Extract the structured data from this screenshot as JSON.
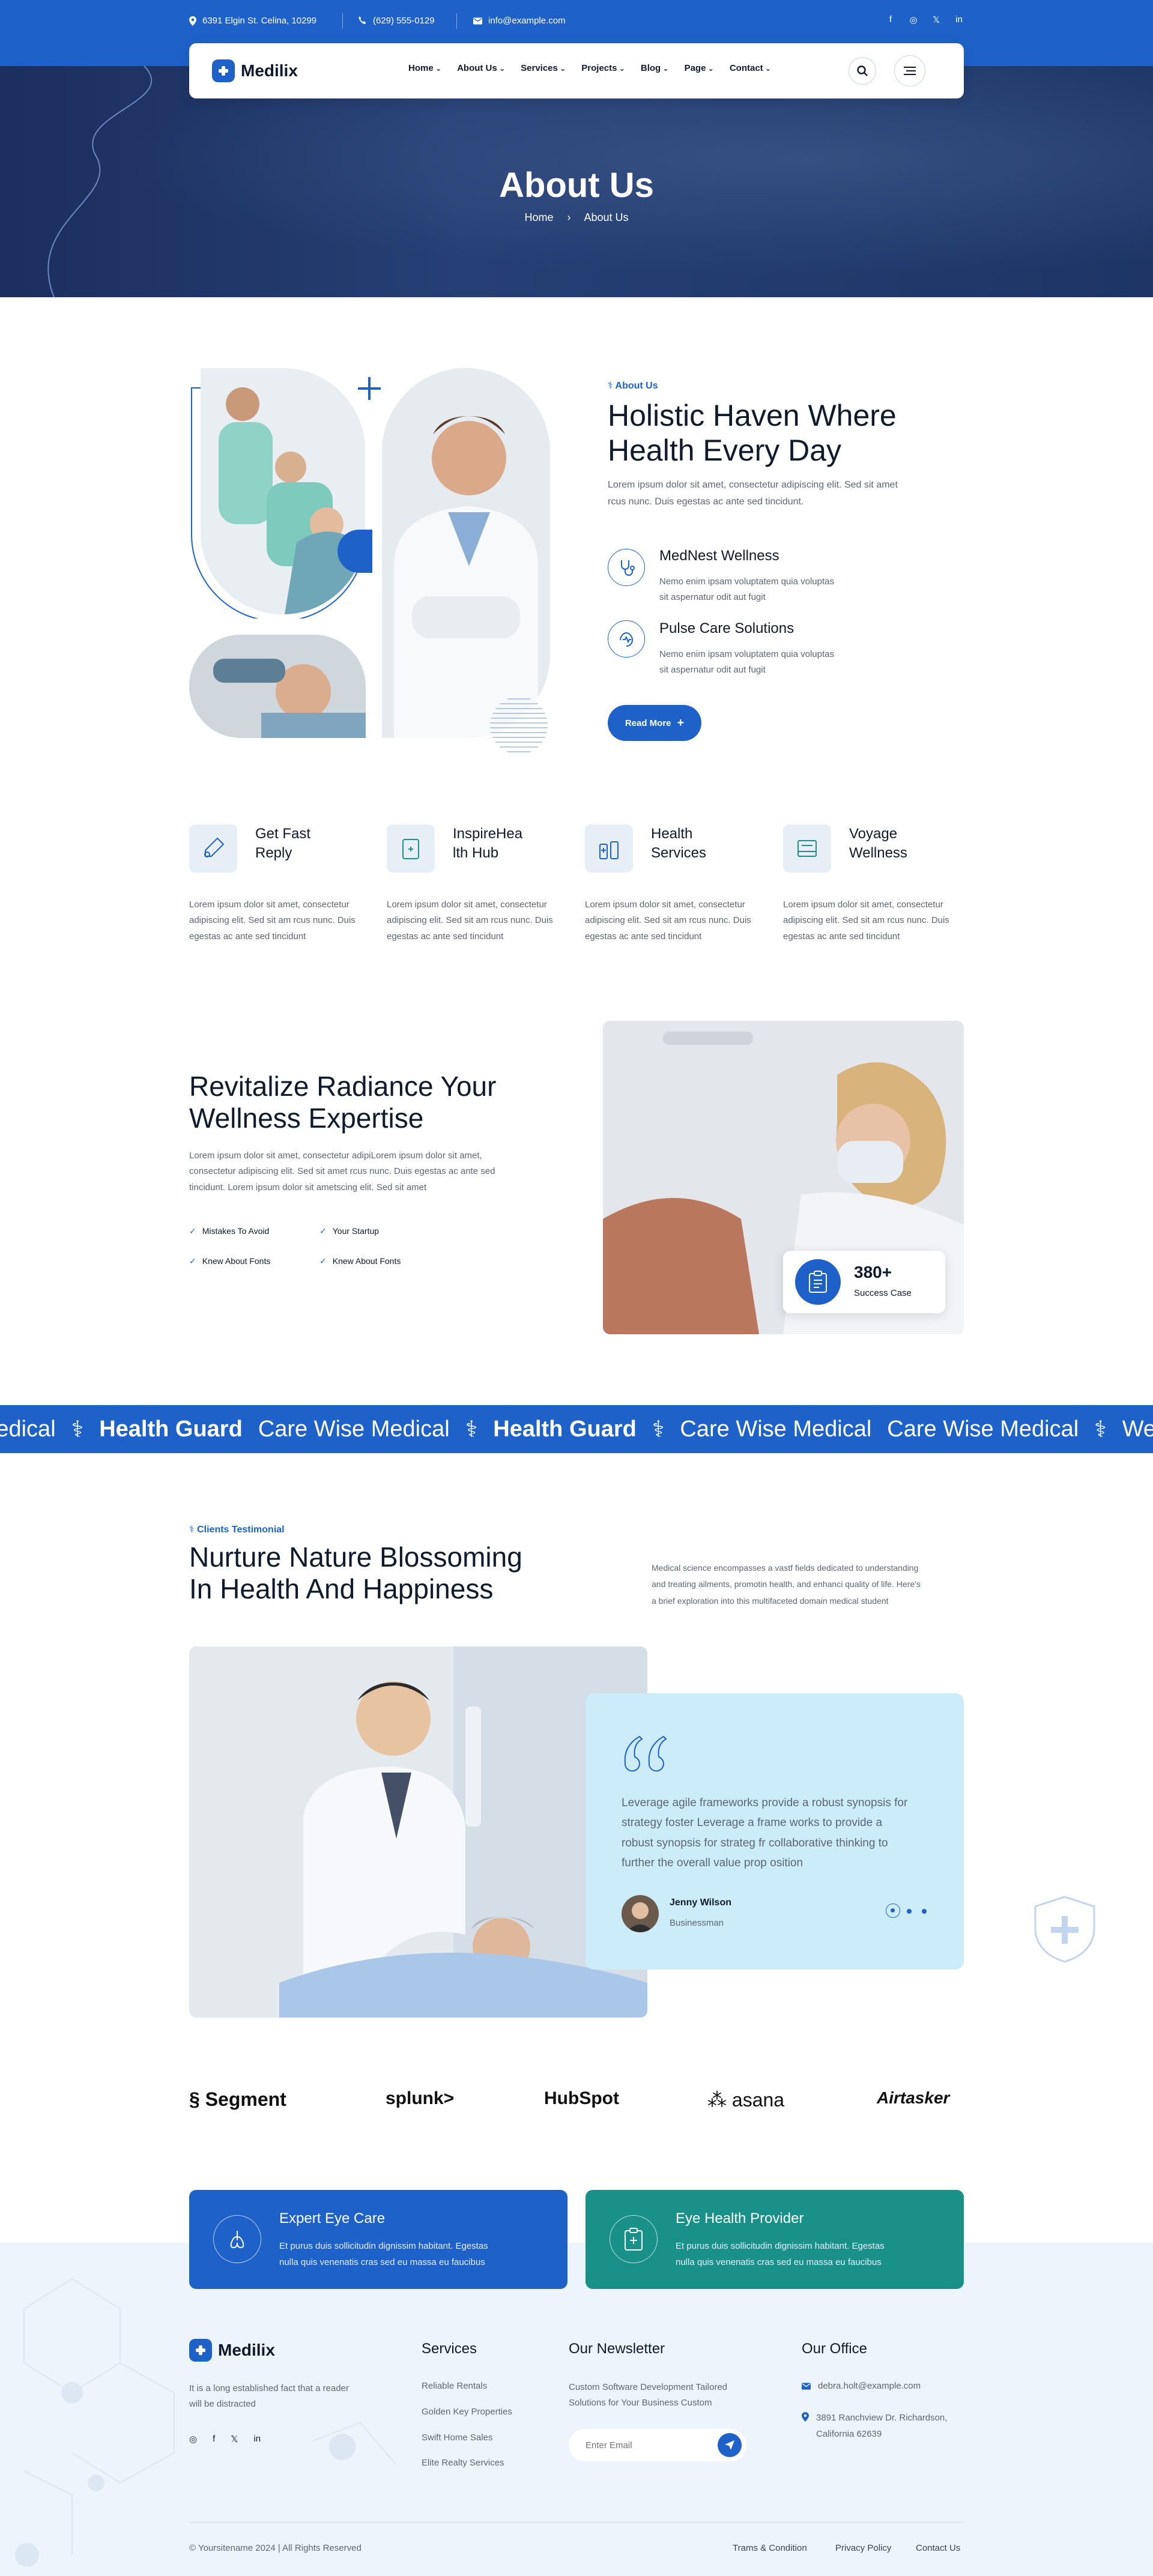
{
  "topbar": {
    "address": "6391 Elgin St. Celina, 10299",
    "phone": "(629) 555-0129",
    "email": "info@example.com",
    "social": [
      "f",
      "◎",
      "𝕏",
      "in"
    ]
  },
  "nav": {
    "logo": "Medilix",
    "menu": [
      "Home",
      "About Us",
      "Services",
      "Projects",
      "Blog",
      "Page",
      "Contact"
    ]
  },
  "hero": {
    "title": "About Us",
    "crumb_home": "Home",
    "crumb_sep": "›",
    "crumb_current": "About Us"
  },
  "about": {
    "tag": "About Us",
    "title_line1": "Holistic Haven Where",
    "title_line2": "Health Every Day",
    "text_line1": "Lorem ipsum dolor sit amet, consectetur adipiscing elit. Sed sit amet",
    "text_line2": "rcus nunc. Duis egestas ac ante sed tincidunt.",
    "features": [
      {
        "title": "MedNest Wellness",
        "line1": "Nemo enim ipsam voluptatem quia voluptas",
        "line2": "sit aspernatur odit aut fugit"
      },
      {
        "title": "Pulse Care Solutions",
        "line1": "Nemo enim ipsam voluptatem quia voluptas",
        "line2": "sit aspernatur odit aut fugit"
      }
    ],
    "button": "Read More",
    "button_icon": "+"
  },
  "services": [
    {
      "line1": "Get Fast",
      "line2": "Reply",
      "d1": "Lorem ipsum dolor sit amet, consectetur",
      "d2": "adipiscing elit. Sed sit am rcus nunc. Duis",
      "d3": "egestas ac ante sed tincidunt"
    },
    {
      "line1": "InspireHea",
      "line2": "lth Hub",
      "d1": "Lorem ipsum dolor sit amet, consectetur",
      "d2": "adipiscing elit. Sed sit am rcus nunc. Duis",
      "d3": "egestas ac ante sed tincidunt"
    },
    {
      "line1": "Health",
      "line2": "Services",
      "d1": "Lorem ipsum dolor sit amet, consectetur",
      "d2": "adipiscing elit. Sed sit am rcus nunc. Duis",
      "d3": "egestas ac ante sed tincidunt"
    },
    {
      "line1": "Voyage",
      "line2": "Wellness",
      "d1": "Lorem ipsum dolor sit amet, consectetur",
      "d2": "adipiscing elit. Sed sit am rcus nunc. Duis",
      "d3": "egestas ac ante sed tincidunt"
    }
  ],
  "revitalize": {
    "title_line1": "Revitalize Radiance Your",
    "title_line2": "Wellness Expertise",
    "text_line1": "Lorem ipsum dolor sit amet, consectetur adipiLorem ipsum dolor sit amet,",
    "text_line2": "consectetur adipiscing elit. Sed sit amet rcus nunc. Duis egestas ac ante sed",
    "text_line3": "tincidunt. Lorem ipsum dolor sit ametscing elit. Sed sit amet",
    "checks": [
      "Mistakes To Avoid",
      "Your Startup",
      "Knew About Fonts",
      "Knew About Fonts"
    ],
    "stat_value": "380+",
    "stat_label": "Success Case"
  },
  "marquee": [
    "e Medical",
    "Health Guard",
    "Care Wise Medical",
    "Health Guard",
    "Care Wise Medical",
    "Care Wise Medical",
    "Well"
  ],
  "testimonial": {
    "tag": "Clients Testimonial",
    "title_line1": "Nurture Nature Blossoming",
    "title_line2": "In Health And Happiness",
    "side_line1": "Medical science encompasses a vastf fields dedicated to understanding",
    "side_line2": "and treating ailments, promotin health, and enhanci quality of life. Here's",
    "side_line3": "a brief exploration into this multifaceted domain medical student",
    "quote_line1": "Leverage agile frameworks  provide a robust synopsis for",
    "quote_line2": "strategy foster Leverage a frame works to provide a",
    "quote_line3": "robust synopsis for strateg fr collaborative thinking to",
    "quote_line4": "further the overall value prop osition",
    "author": "Jenny Wilson",
    "role": "Businessman"
  },
  "brands": [
    "Segment",
    "splunk>",
    "HubSpot",
    "asana",
    "Airtasker"
  ],
  "cta": [
    {
      "title": "Expert Eye Care",
      "line1": "Et purus duis sollicitudin dignissim habitant. Egestas",
      "line2": "nulla quis venenatis cras sed eu massa eu faucibus"
    },
    {
      "title": "Eye Health Provider",
      "line1": "Et purus duis sollicitudin dignissim habitant. Egestas",
      "line2": "nulla quis venenatis cras sed eu massa eu faucibus"
    }
  ],
  "footer": {
    "logo": "Medilix",
    "about_line1": "It is a long established fact that a reader",
    "about_line2": "will be distracted",
    "social": [
      "◎",
      "f",
      "𝕏",
      "in"
    ],
    "services_title": "Services",
    "services": [
      "Reliable Rentals",
      "Golden Key Properties",
      "Swift Home Sales",
      "Elite Realty Services"
    ],
    "newsletter_title": "Our Newsletter",
    "newsletter_line1": "Custom Software Development Tailored",
    "newsletter_line2": "Solutions for Your Business Custom",
    "email_placeholder": "Enter Email",
    "office_title": "Our Office",
    "office_email": "debra.holt@example.com",
    "office_addr1": "3891 Ranchview Dr. Richardson,",
    "office_addr2": "California 62639",
    "copyright": "© Yoursitename  2024 | All Rights Reserved",
    "links": [
      "Trams & Condition",
      "Privacy Policy",
      "Contact Us"
    ]
  },
  "colors": {
    "primary": "#1e62c9",
    "teal": "#1a9188",
    "dark": "#0f1b2d",
    "quote_bg": "#ccecfa",
    "footer_bg": "#eef4fb"
  }
}
